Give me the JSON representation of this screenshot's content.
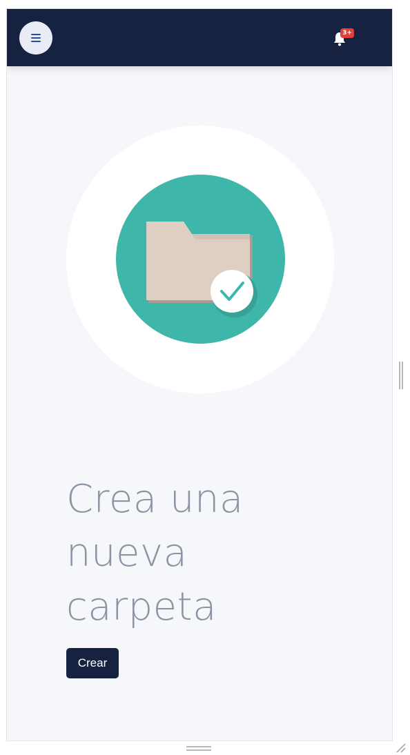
{
  "header": {
    "menu_icon": "hamburger-menu-icon",
    "notification_icon": "bell-icon",
    "notification_badge": "3+",
    "background_color": "#162240"
  },
  "hero": {
    "illustration": "folder-with-check-icon",
    "circle_color": "#3fb6aa",
    "headline_lines": [
      "Crea una",
      "nueva",
      "carpeta"
    ]
  },
  "actions": {
    "create_label": "Crear"
  },
  "colors": {
    "accent": "#3fb6aa",
    "primary": "#162240",
    "badge": "#e0413a"
  }
}
